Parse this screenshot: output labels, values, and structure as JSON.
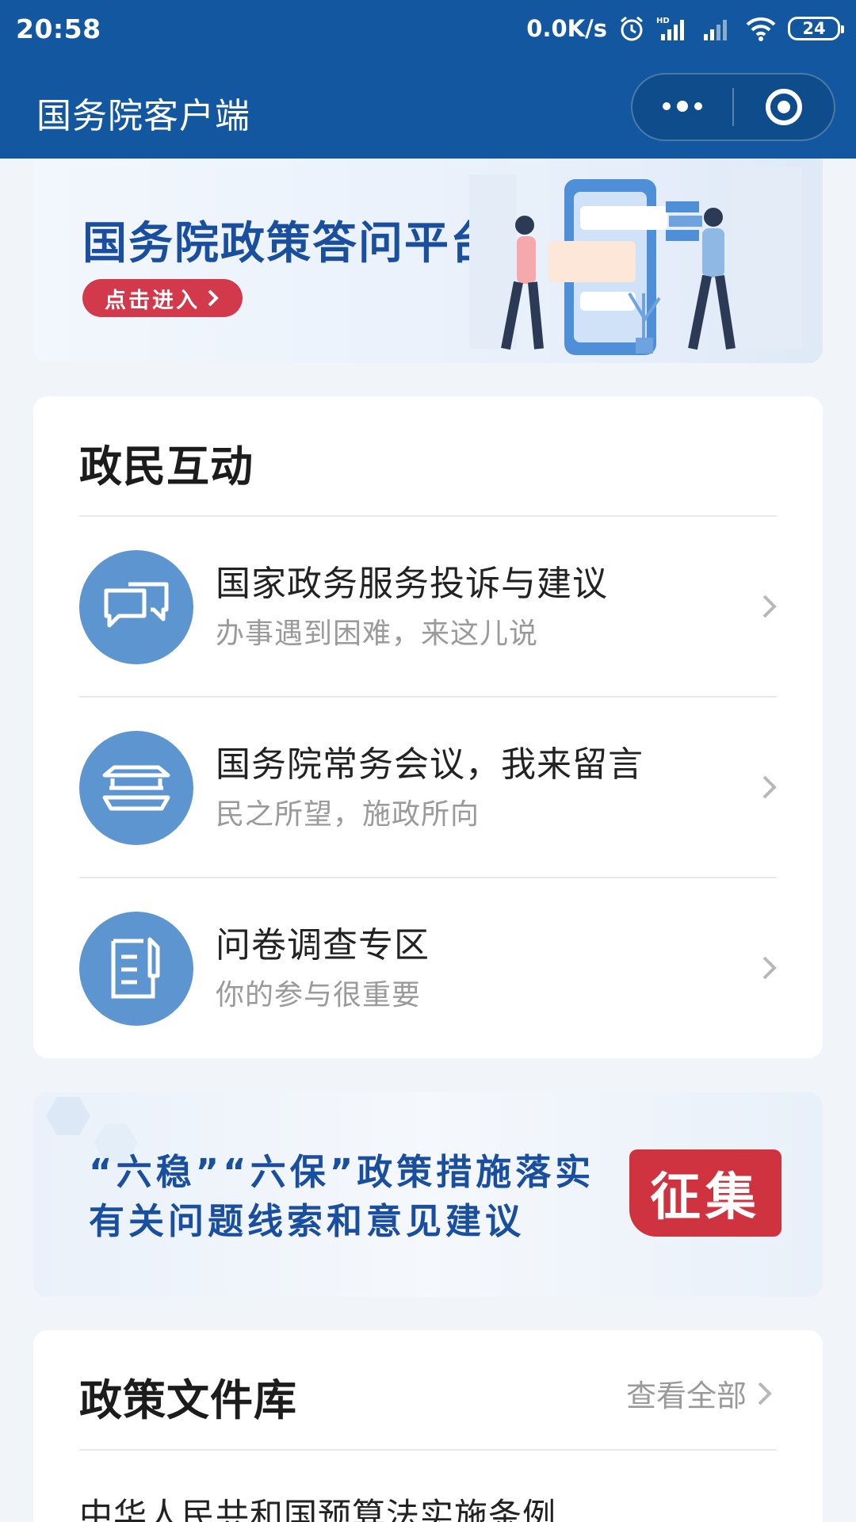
{
  "status_bar": {
    "time": "20:58",
    "net_speed": "0.0K/s",
    "battery": "24"
  },
  "app": {
    "title": "国务院客户端"
  },
  "banner_top": {
    "title": "国务院政策答问平台",
    "button": "点击进入"
  },
  "interaction": {
    "title": "政民互动",
    "items": [
      {
        "title": "国家政务服务投诉与建议",
        "subtitle": "办事遇到困难，来这儿说",
        "icon": "chat-bubbles-icon"
      },
      {
        "title": "国务院常务会议，我来留言",
        "subtitle": "民之所望，施政所向",
        "icon": "building-icon"
      },
      {
        "title": "问卷调查专区",
        "subtitle": "你的参与很重要",
        "icon": "survey-icon"
      }
    ]
  },
  "banner_mid": {
    "line1": "“六稳”“六保”政策措施落实",
    "line2": "有关问题线索和意见建议",
    "badge": "征集"
  },
  "policy": {
    "title": "政策文件库",
    "view_all": "查看全部",
    "first_item": "中华人民共和国预算法实施条例"
  },
  "colors": {
    "header": "#12579f",
    "accent_blue": "#1a4fa0",
    "accent_red": "#d2394a",
    "icon_circle": "#5d95d0"
  }
}
